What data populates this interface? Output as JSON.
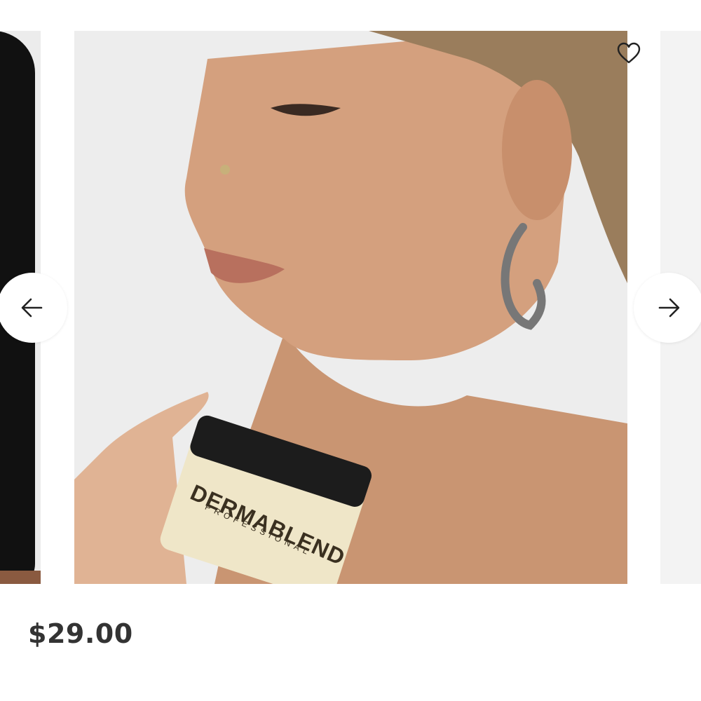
{
  "product": {
    "price": "$29.00",
    "jar_brand": "DERMABLEND",
    "jar_sub": "PROFESSIONAL"
  },
  "carousel": {
    "prev_icon": "arrow-left-icon",
    "next_icon": "arrow-right-icon",
    "favorite_icon": "heart-outline-icon"
  },
  "colors": {
    "background": "#ffffff",
    "price_text": "#333333",
    "slide_bg": "#ededed"
  }
}
